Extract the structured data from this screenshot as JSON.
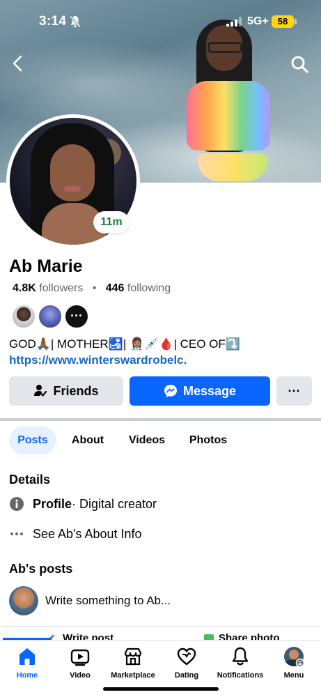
{
  "status_bar": {
    "time": "3:14",
    "network": "5G+",
    "battery": "58"
  },
  "profile": {
    "name": "Ab Marie",
    "followers_count": "4.8K",
    "followers_label": "followers",
    "following_count": "446",
    "following_label": "following",
    "story_badge": "11m",
    "mutual_more": "···",
    "bio_line": "GOD🙏🏾| MOTHER🛃| 👩🏽‍⚕️💉🩸| CEO OF⤵️",
    "bio_link": "https://www.winterswardrobelc."
  },
  "actions": {
    "friends": "Friends",
    "message": "Message",
    "more": "···"
  },
  "tabs": [
    {
      "label": "Posts",
      "active": true
    },
    {
      "label": "About",
      "active": false
    },
    {
      "label": "Videos",
      "active": false
    },
    {
      "label": "Photos",
      "active": false
    }
  ],
  "details": {
    "title": "Details",
    "profile_label": "Profile",
    "profile_value": " · Digital creator",
    "see_about": "See Ab's About Info"
  },
  "posts": {
    "title": "Ab's posts",
    "composer_placeholder": "Write something to Ab...",
    "write_post": "Write post",
    "share_photo": "Share photo"
  },
  "bottom_nav": [
    {
      "label": "Home",
      "icon": "home-icon",
      "active": true
    },
    {
      "label": "Video",
      "icon": "video-icon",
      "active": false
    },
    {
      "label": "Marketplace",
      "icon": "marketplace-icon",
      "active": false
    },
    {
      "label": "Dating",
      "icon": "heart-icon",
      "active": false
    },
    {
      "label": "Notifications",
      "icon": "bell-icon",
      "active": false
    },
    {
      "label": "Menu",
      "icon": "avatar-icon",
      "active": false
    }
  ],
  "colors": {
    "accent": "#0866ff",
    "link": "#1467c8",
    "badge_text": "#1b7f3b",
    "battery": "#ffd60a"
  }
}
